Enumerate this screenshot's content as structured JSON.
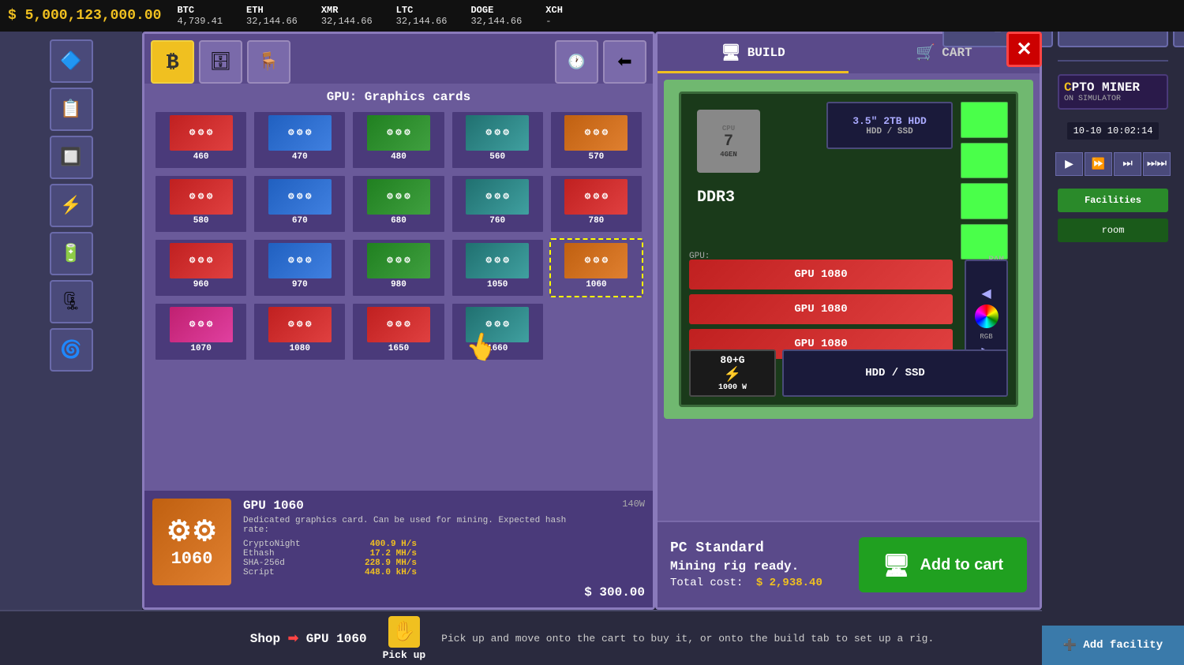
{
  "topbar": {
    "balance": "$ 5,000,123,000.00",
    "tickers": [
      {
        "name": "BTC",
        "value": "4,739.41"
      },
      {
        "name": "ETH",
        "value": "32,144.66"
      },
      {
        "name": "XMR",
        "value": "32,144.66"
      },
      {
        "name": "LTC",
        "value": "32,144.66"
      },
      {
        "name": "DOGE",
        "value": "32,144.66"
      },
      {
        "name": "XCH",
        "value": "-"
      }
    ]
  },
  "shop": {
    "title": "GPU: Graphics cards",
    "tabs": [
      {
        "id": "bitcoin",
        "icon": "₿",
        "active": true
      },
      {
        "id": "storage",
        "icon": "🗄",
        "active": false
      },
      {
        "id": "chair",
        "icon": "🪑",
        "active": false
      },
      {
        "id": "back",
        "icon": "⬅",
        "active": false
      }
    ],
    "gpus": [
      {
        "id": "460",
        "label": "460",
        "model": "GPU",
        "color": "red"
      },
      {
        "id": "470",
        "label": "470",
        "model": "GPU",
        "color": "blue"
      },
      {
        "id": "480",
        "label": "480",
        "model": "GPU",
        "color": "green"
      },
      {
        "id": "560",
        "label": "560",
        "model": "GPU",
        "color": "teal"
      },
      {
        "id": "570",
        "label": "570",
        "model": "GPU",
        "color": "orange"
      },
      {
        "id": "580",
        "label": "580",
        "model": "GPU",
        "color": "red"
      },
      {
        "id": "670",
        "label": "670",
        "model": "GPU",
        "color": "blue"
      },
      {
        "id": "680",
        "label": "680",
        "model": "GPU",
        "color": "green"
      },
      {
        "id": "760",
        "label": "760",
        "model": "GPU",
        "color": "teal"
      },
      {
        "id": "780",
        "label": "780",
        "model": "GPU",
        "color": "red"
      },
      {
        "id": "960",
        "label": "960",
        "model": "GPU",
        "color": "red"
      },
      {
        "id": "970",
        "label": "970",
        "model": "GPU",
        "color": "blue"
      },
      {
        "id": "980",
        "label": "980",
        "model": "GPU",
        "color": "green"
      },
      {
        "id": "1050",
        "label": "1050",
        "model": "GPU",
        "color": "teal"
      },
      {
        "id": "1060",
        "label": "1060",
        "model": "GPU",
        "color": "orange",
        "selected": true
      },
      {
        "id": "1070",
        "label": "1070",
        "model": "GPU",
        "color": "pink"
      },
      {
        "id": "1080",
        "label": "1080",
        "model": "GPU",
        "color": "red"
      },
      {
        "id": "1650",
        "label": "1650",
        "model": "GPU",
        "color": "red"
      },
      {
        "id": "1660",
        "label": "1660",
        "model": "GPU",
        "color": "teal"
      }
    ],
    "selected_gpu": {
      "name": "GPU 1060",
      "wattage": "140W",
      "description": "Dedicated graphics card. Can be used for mining. Expected hash rate:",
      "stats": [
        {
          "algo": "CryptoNight",
          "rate": "400.9 H/s"
        },
        {
          "algo": "Ethash",
          "rate": "17.2 MH/s"
        },
        {
          "algo": "SHA-256d",
          "rate": "228.9 MH/s"
        },
        {
          "algo": "Script",
          "rate": "448.0 kH/s"
        }
      ],
      "price": "$ 300.00"
    }
  },
  "build": {
    "tabs": [
      {
        "id": "build",
        "label": "BUILD",
        "icon": "🖥",
        "active": true
      },
      {
        "id": "cart",
        "label": "CART",
        "icon": "🛒",
        "active": false
      }
    ],
    "pc": {
      "cpu": {
        "gen": "7",
        "label": "4GEN"
      },
      "ram": "DDR3",
      "hdd_top": "3.5\" 2TB HDD",
      "installed_gpus": [
        "GPU 1080",
        "GPU 1080",
        "GPU 1080"
      ],
      "power": {
        "main": "80+G",
        "wattage": "1000 W"
      },
      "hdd_bottom": "HDD / SSD"
    },
    "info": {
      "rig_name": "PC Standard",
      "status": "Mining rig ready.",
      "total_cost_label": "Total cost:",
      "total_cost": "$ 2,938.40"
    },
    "add_to_cart_label": "Add to cart"
  },
  "bottom": {
    "breadcrumb_shop": "Shop",
    "breadcrumb_item": "GPU 1060",
    "pickup_label": "Pick up",
    "hint": "Pick up and move onto the cart to buy it, or onto the build tab to set up a rig."
  },
  "game": {
    "logo": "PTO MINER",
    "subtitle": "ON SIMULATOR",
    "time": "10-10 10:02:14",
    "add_facility": "Add facility"
  },
  "sidebar": {
    "items": [
      {
        "id": "cube",
        "icon": "🔷"
      },
      {
        "id": "list",
        "icon": "📋"
      },
      {
        "id": "chip",
        "icon": "🔲"
      },
      {
        "id": "grid",
        "icon": "⚡"
      },
      {
        "id": "battery",
        "icon": "🔋"
      },
      {
        "id": "cylinder",
        "icon": "🗜"
      },
      {
        "id": "fan",
        "icon": "🌀"
      }
    ]
  },
  "icons": {
    "close": "✕",
    "cart_tab": "🛒",
    "build_tab": "🖥",
    "play": "▶",
    "fast_forward": "⏩",
    "faster": "⏭"
  }
}
